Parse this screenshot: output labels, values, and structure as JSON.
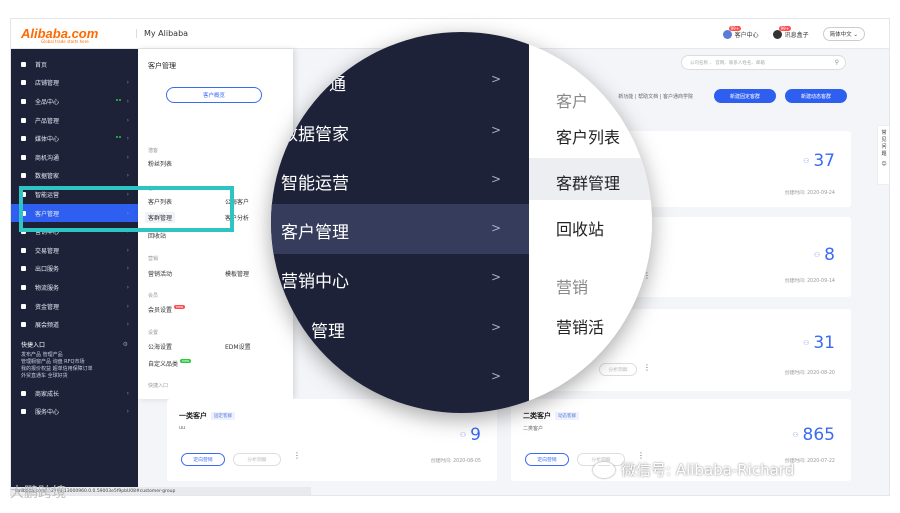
{
  "topbar": {
    "logo": "Alibaba.com",
    "logo_tagline": "Global trade starts here",
    "app_title": "My Alibaba",
    "msg_center": "客户中心",
    "msg_center_badge": "99+",
    "notify": "讯息盒子",
    "notify_badge": "99+",
    "language": "简体中文"
  },
  "sidebar": {
    "items": [
      {
        "label": "首页",
        "arrow": false
      },
      {
        "label": "店铺管理",
        "arrow": true
      },
      {
        "label": "全品中心",
        "arrow": true,
        "dots": true
      },
      {
        "label": "产品管理",
        "arrow": true
      },
      {
        "label": "媒体中心",
        "arrow": true,
        "dots": true
      },
      {
        "label": "商机沟通",
        "arrow": true
      },
      {
        "label": "数据管家",
        "arrow": true
      },
      {
        "label": "智能运营",
        "arrow": true
      },
      {
        "label": "客户管理",
        "arrow": true,
        "active": true
      },
      {
        "label": "营销中心",
        "arrow": true
      },
      {
        "label": "交易管理",
        "arrow": true
      },
      {
        "label": "出口服务",
        "arrow": true
      },
      {
        "label": "物流服务",
        "arrow": true
      },
      {
        "label": "资金管理",
        "arrow": true
      },
      {
        "label": "展会频道",
        "arrow": true
      }
    ],
    "quick_title": "快捷入口",
    "quick_links": [
      "发布产品  管理产品",
      "管理橱窗产品  询盘  RFQ市场",
      "我的报价权益  超单信用保障订单",
      "外贸直通车  全球好货"
    ],
    "bottom_items": [
      {
        "label": "商家成长",
        "arrow": true
      },
      {
        "label": "服务中心",
        "arrow": true
      }
    ]
  },
  "submenu": {
    "title": "客户管理",
    "overview_button": "客户概览",
    "sections": {
      "fans": "潜客",
      "customer": "客户",
      "marketing": "营销",
      "member": "会员",
      "settings": "设置",
      "quick": "快捷入口"
    },
    "items": {
      "fans_list": "粉丝列表",
      "customer_list": "客户列表",
      "public_customer": "公海客户",
      "group_manage": "客群管理",
      "customer_analysis": "客户分析",
      "recycle": "回收站",
      "marketing_activity": "营销活动",
      "template_manage": "模板管理",
      "member_settings": "会员设置",
      "public_settings": "公海设置",
      "edm_settings": "EDM设置",
      "custom_category": "自定义品类"
    }
  },
  "content": {
    "header_links": "新功能 | 帮助文档 | 客户通商学院",
    "search_placeholder": "公司名称 、 官网、联系人姓名、邮箱",
    "btn_new_fixed": "新建固定客群",
    "btn_new_dynamic": "新建动态客群",
    "cards": [
      {
        "title": "",
        "tag": "",
        "sub": "",
        "count": "37",
        "date": "创建时间: 2020-09-24"
      },
      {
        "title": "",
        "tag": "",
        "sub": "",
        "count": "8",
        "date": "创建时间: 2020-09-14"
      },
      {
        "title": "",
        "tag": "",
        "sub": "",
        "count": "31",
        "date": "创建时间: 2020-08-20"
      },
      {
        "title": "一类客户",
        "tag": "固定客群",
        "sub": "uu",
        "count": "9",
        "date": "创建时间: 2020-08-05"
      },
      {
        "title": "二类客户",
        "tag": "动态客群",
        "sub": "二类客户",
        "count": "865",
        "date": "创建时间: 2020-07-22"
      }
    ],
    "card_btn_target": "定向营销",
    "card_btn_analysis": "分析洞察"
  },
  "side_tab": [
    "常",
    "见",
    "问",
    "题"
  ],
  "status_url": "i.alibaba.com/...2793.13000960.0.0.59003e5f9pbU08#customer-group",
  "magnifier": {
    "nav": [
      "数据管家",
      "智能运营",
      "客户管理",
      "营销中心",
      "管理"
    ],
    "nav_top_partial": "通",
    "right_items": [
      {
        "label": "客户",
        "muted": true
      },
      {
        "label": "客户列表",
        "muted": false
      },
      {
        "label": "客群管理",
        "muted": false
      },
      {
        "label": "回收站",
        "muted": false
      },
      {
        "label": "营销",
        "muted": true
      },
      {
        "label": "营销活",
        "muted": false
      }
    ]
  },
  "watermark": "微信号: Alibaba-Richard",
  "bottom_watermark": "大鹏跨境"
}
